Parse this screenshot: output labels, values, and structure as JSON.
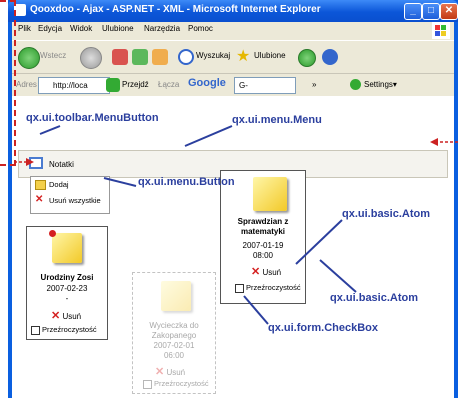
{
  "window": {
    "title": "Qooxdoo - Ajax - ASP.NET - XML - Microsoft Internet Explorer",
    "minimize_glyph": "_",
    "maximize_glyph": "□",
    "close_glyph": "✕"
  },
  "menubar": [
    "Plik",
    "Edycja",
    "Widok",
    "Ulubione",
    "Narzędzia",
    "Pomoc"
  ],
  "toolbar": {
    "back_label": "Wstecz",
    "search_label": "Wyszukaj",
    "favorites_label": "Ulubione"
  },
  "addressbar": {
    "label": "Adres",
    "url": "http://loca",
    "go_label": "Przejdź",
    "links_label": "Łącza",
    "google_label": "Google",
    "google_box": "G-",
    "more": "»",
    "settings_label": "Settings▾"
  },
  "app": {
    "toolbar_button": "Notatki",
    "menu_items": [
      "Dodaj",
      "Usuń wszystkie"
    ],
    "notes": [
      {
        "title": "Urodziny Zosi",
        "date": "2007-02-23",
        "sub": "-",
        "delete": "Usuń",
        "checkbox": "Przeźroczystość"
      },
      {
        "title": "Sprawdzian z matematyki",
        "date": "2007-01-19",
        "sub": "08:00",
        "delete": "Usuń",
        "checkbox": "Przeźroczystość"
      },
      {
        "title": "Wycieczka do Zakopanego",
        "date": "2007-02-01",
        "sub": "06:00",
        "delete": "Usuń",
        "checkbox": "Przeźroczystość"
      }
    ]
  },
  "annotations": {
    "menubutton": "qx.ui.toolbar.MenuButton",
    "menu": "qx.ui.menu.Menu",
    "button": "qx.ui.menu.Button",
    "atom1": "qx.ui.basic.Atom",
    "atom2": "qx.ui.basic.Atom",
    "checkbox": "qx.ui.form.CheckBox"
  },
  "colors": {
    "annotation": "#2b3f9e",
    "callout": "#cc2222",
    "titlebar": "#0b56d8"
  }
}
